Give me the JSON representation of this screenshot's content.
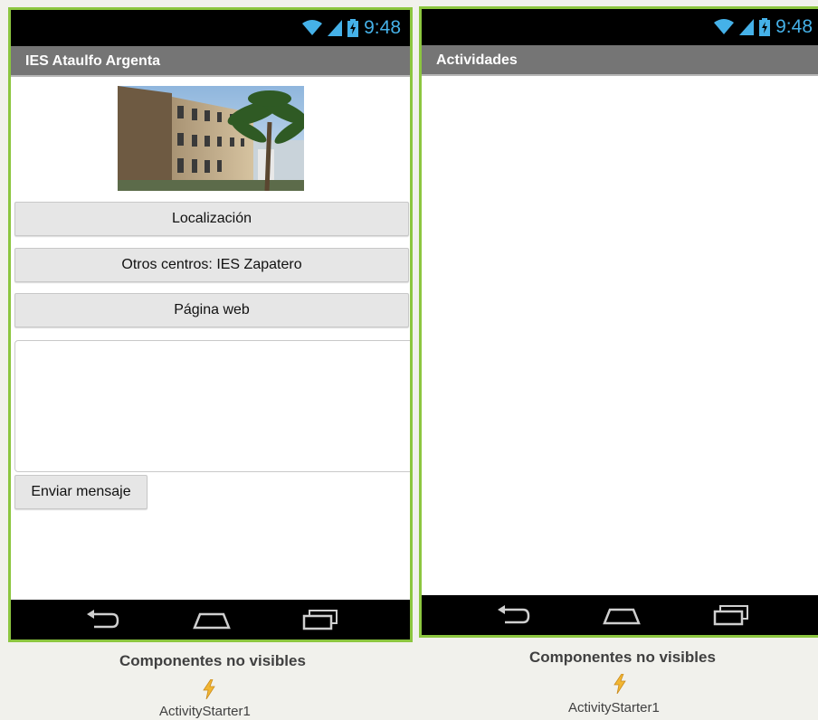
{
  "screens": [
    {
      "status_time": "9:48",
      "title": "IES Ataulfo Argenta",
      "buttons": {
        "location": "Localización",
        "other_centers": "Otros centros: IES Zapatero",
        "web_page": "Página web"
      },
      "message_text": "",
      "send_button": "Enviar mensaje"
    },
    {
      "status_time": "9:48",
      "title": "Actividades"
    }
  ],
  "non_visible": [
    {
      "title": "Componentes no visibles",
      "component": "ActivityStarter1"
    },
    {
      "title": "Componentes no visibles",
      "component": "ActivityStarter1"
    }
  ],
  "icons": [
    "wifi-icon",
    "signal-icon",
    "battery-icon",
    "back-icon",
    "home-icon",
    "recents-icon",
    "lightning-icon"
  ],
  "colors": {
    "frame_border": "#8cc63f",
    "status_accent": "#45b1e8",
    "title_bar": "#757575"
  }
}
